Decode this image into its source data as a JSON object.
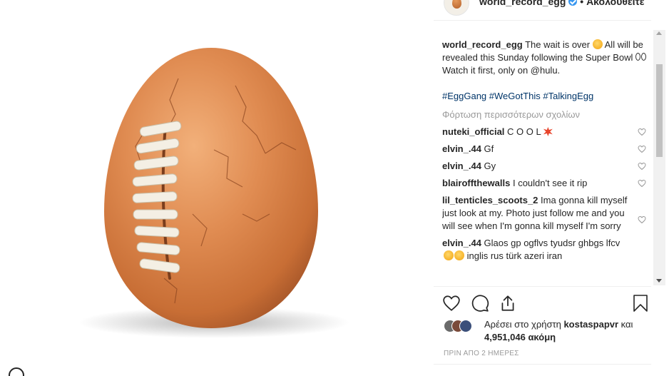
{
  "post": {
    "username": "world_record_egg",
    "separator": "•",
    "follow_label": "Ακολουθείτε",
    "caption_username": "world_record_egg",
    "caption_text_1": " The wait is over ",
    "caption_text_2": " All will be revealed this Sunday following the Super Bowl ",
    "caption_line_3": "Watch it first, only on @hulu.",
    "hashtags": "#EggGang #WeGotThis #TalkingEgg",
    "load_more": "Φόρτωση περισσότερων σχολίων"
  },
  "comments": [
    {
      "username": "nuteki_official",
      "text": " C O O L "
    },
    {
      "username": "elvin_.44",
      "text": " Gf"
    },
    {
      "username": "elvin_.44",
      "text": " Gy"
    },
    {
      "username": "blairoffthewalls",
      "text": " I couldn't see it rip"
    },
    {
      "username": "lil_tenticles_scoots_2",
      "text": " Ima gonna kill myself just look at my. Photo just follow me and you will see when I'm gonna kill myself I'm sorry"
    },
    {
      "username": "elvin_.44",
      "text": " Glaos gp ogflvs tyudsr ghbgs lfcv",
      "text_2": " inglis rus türk azeri iran"
    }
  ],
  "likes": {
    "prefix": "Αρέσει στο χρήστη ",
    "user": "kostaspapvr",
    "mid": " και",
    "count": "4,951,046 ακόμη"
  },
  "timestamp": "ΠΡΙΝ ΑΠΟ 2 ΗΜΕΡΕΣ",
  "icons": {
    "like": "heart-icon",
    "comment": "comment-icon",
    "share": "share-icon",
    "save": "bookmark-icon"
  },
  "colors": {
    "hashtag": "#003569",
    "verified": "#3897f0",
    "muted": "#999999"
  }
}
